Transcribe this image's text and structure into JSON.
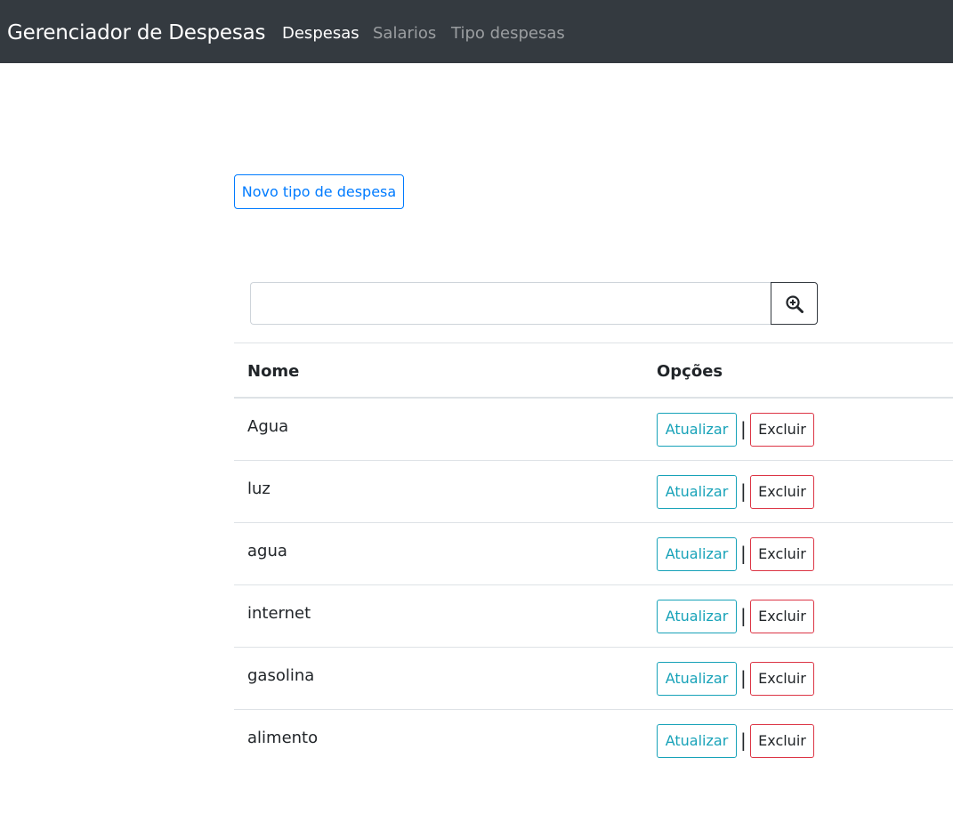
{
  "navbar": {
    "brand": "Gerenciador de Despesas",
    "links": [
      {
        "label": "Despesas",
        "active": true
      },
      {
        "label": "Salarios",
        "active": false
      },
      {
        "label": "Tipo despesas",
        "active": false
      }
    ]
  },
  "actions": {
    "new_label": "Novo tipo de despesa"
  },
  "search": {
    "value": "",
    "placeholder": "",
    "button_icon": "zoom-in-icon"
  },
  "table": {
    "headers": {
      "nome": "Nome",
      "opcoes": "Opções"
    },
    "rows": [
      {
        "nome": "Agua"
      },
      {
        "nome": "luz"
      },
      {
        "nome": "agua"
      },
      {
        "nome": "internet"
      },
      {
        "nome": "gasolina"
      },
      {
        "nome": "alimento"
      }
    ],
    "update_label": "Atualizar",
    "separator": "|",
    "delete_label": "Excluir"
  },
  "colors": {
    "navbar_bg": "#343a40",
    "primary": "#007bff",
    "info": "#17a2b8",
    "danger": "#dc3545"
  }
}
